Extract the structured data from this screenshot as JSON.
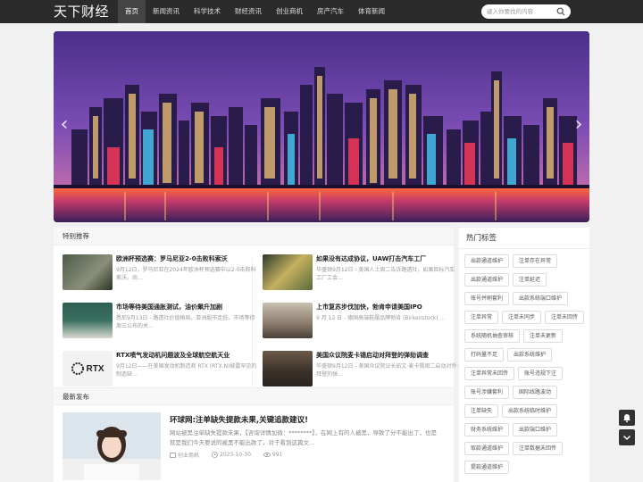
{
  "header": {
    "logo": "天下财经",
    "nav": [
      "首页",
      "新闻资讯",
      "科学技术",
      "财经资讯",
      "创业商机",
      "房产汽车",
      "体育新闻"
    ],
    "active_nav": "首页",
    "search_placeholder": "键入你要找的内容"
  },
  "banner": {
    "prev_icon": "chevron-left-icon",
    "next_icon": "chevron-right-icon"
  },
  "featured": {
    "heading": "特别推荐",
    "items": [
      {
        "title": "欧洲杯预选赛：罗马尼亚2-0击败科索沃",
        "desc": "9月12日，罗马尼亚在2024年欧洲杯预选赛中以2-0击败科索沃。尚…"
      },
      {
        "title": "如果没有达成协议，UAW打击汽车工厂",
        "desc": "华盛顿9月12日 - 美国人士周二告诉路透社，如果目标汽车工厂工会…"
      },
      {
        "title": "市场等待美国通胀测试，油价飙升加剧",
        "desc": "悉尼9月13日 - 路透社价值格局。亚洲股市走低，市场等待周三公布的关…"
      },
      {
        "title": "上市复苏步伐加快，勃肯申请美国IPO",
        "desc": "9 月 12 日 - 德国高端鞋履品牌勃肯 (Birkenstock) …"
      },
      {
        "title": "RTX喷气发动机问题波及全球航空航天业",
        "desc": "9月12日——在美国发动机制造商 RTX (RTX.N)披露罕见的制造缺…"
      },
      {
        "title": "美国众议院麦卡锡启动对拜登的弹劾调查",
        "desc": "华盛顿9月12日 - 美国众议院议长凯文·麦卡锡周二启动对乔·拜登的弹…"
      }
    ]
  },
  "latest": {
    "heading": "最新发布",
    "items": [
      {
        "title": "环球网:注单缺失提款未果,关键追款建议!",
        "desc": "网站被黑注单缺失提款未果，【咨询详情加微：********】，在网上有的人被黑，导致了分不能出了，也是就是我们今天要说的被黑不能出款了，对于看到这篇文…",
        "category": "创业商机",
        "date": "2023-10-30",
        "views": "991"
      }
    ]
  },
  "sidebar": {
    "heading": "热门标签",
    "tags": [
      "出款通道维护",
      "注单存在异常",
      "出款通道维护",
      "注单延迟",
      "账号并刷套利",
      "出款系统端口维护",
      "注单异常",
      "注单未同步",
      "注单未回传",
      "系统随机抽查审核",
      "注单未更新",
      "打码量不足",
      "出款系统维护",
      "注单异常未回传",
      "账号违规下注",
      "账号涉嫌套利",
      "国际线路波动",
      "注单缺失",
      "出款系统临时维护",
      "财务系统维护",
      "出款端口维护",
      "取款通道维护",
      "注单数据未回传",
      "提款通道维护"
    ]
  },
  "float_buttons": [
    "bell-icon",
    "chevron-down-icon"
  ]
}
